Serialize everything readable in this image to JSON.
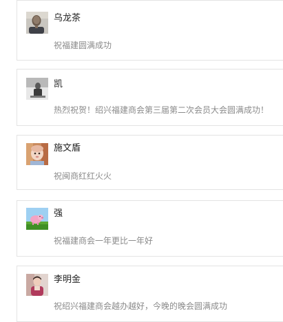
{
  "comments": [
    {
      "username": "乌龙茶",
      "message": "祝福建圆满成功",
      "avatar": "person-photo-avatar"
    },
    {
      "username": "凯",
      "message": "热烈祝贺！绍兴福建商会第三届第二次会员大会圆满成功！",
      "avatar": "person-photo-avatar"
    },
    {
      "username": "施文盾",
      "message": "祝闽商红红火火",
      "avatar": "baby-photo-avatar"
    },
    {
      "username": "强",
      "message": "祝福建商会一年更比一年好",
      "avatar": "cartoon-pig-avatar"
    },
    {
      "username": "李明金",
      "message": "祝绍兴福建商会越办越好，今晚的晚会圆满成功",
      "avatar": "person-photo-avatar"
    }
  ]
}
